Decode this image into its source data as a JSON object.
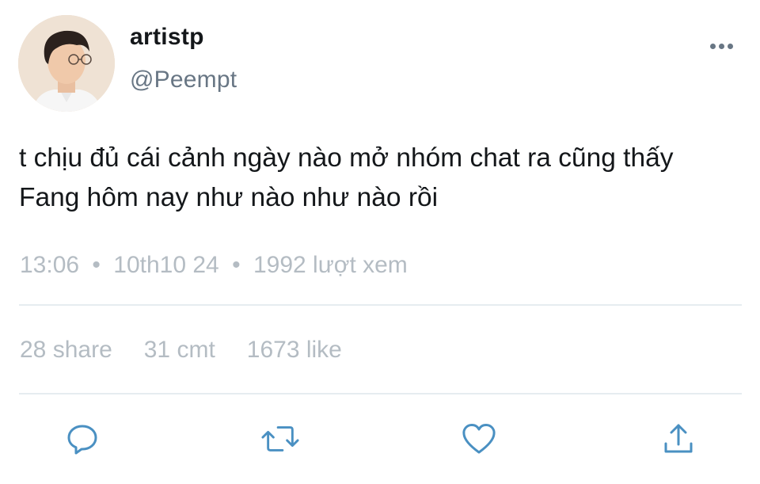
{
  "author": {
    "display_name": "artistp",
    "handle": "@Peempt"
  },
  "tweet": {
    "lines": [
      "t chịu đủ cái cảnh ngày nào mở nhóm chat ra cũng thấy",
      "Fang hôm nay như nào như nào rồi"
    ]
  },
  "meta": {
    "time": "13:06",
    "date": "10th10 24",
    "views": "1992 lượt xem",
    "separator": "•"
  },
  "stats": {
    "shares": "28 share",
    "comments": "31 cmt",
    "likes": "1673 like"
  },
  "icons": {
    "more": "more-horizontal-icon",
    "reply": "comment-icon",
    "retweet": "retweet-icon",
    "like": "heart-icon",
    "share": "share-upload-icon"
  },
  "colors": {
    "text_primary": "#14171a",
    "text_secondary": "#687684",
    "text_muted": "#b4bcc3",
    "icon": "#4a90c2",
    "divider": "#e6ecf0"
  }
}
